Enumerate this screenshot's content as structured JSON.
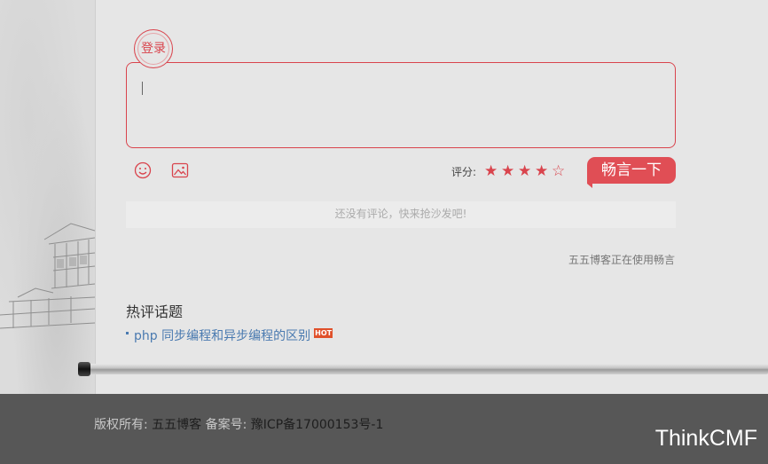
{
  "comment": {
    "login_label": "登录",
    "rating_label": "评分:",
    "rating": 4,
    "rating_max": 5,
    "submit_label": "畅言一下",
    "empty_notice": "还没有评论，快来抢沙发吧!",
    "powered_by": "五五博客正在使用畅言",
    "icons": {
      "emoji": "smile-icon",
      "image": "image-icon",
      "star_full": "★",
      "star_empty": "☆"
    }
  },
  "hot": {
    "title": "热评话题",
    "items": [
      {
        "text": "php 同步编程和异步编程的区别",
        "tag": "HOT"
      }
    ]
  },
  "footer": {
    "copyright_label": "版权所有:",
    "copyright_value": "五五博客",
    "icp_label": "备案号:",
    "icp_value": "豫ICP备17000153号-1",
    "brand": "ThinkCMF"
  },
  "colors": {
    "accent": "#d9444d",
    "link": "#4a7ab0",
    "footer_bg": "#575757"
  }
}
